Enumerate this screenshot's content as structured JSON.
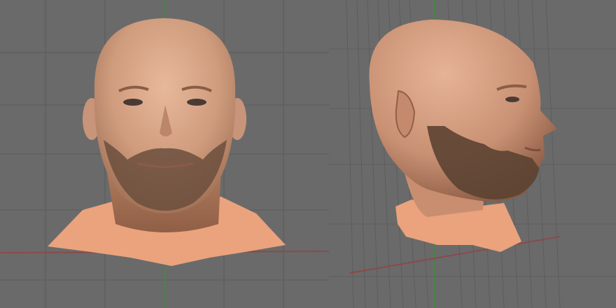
{
  "scene": {
    "background_color": "#6a6a6a",
    "grid_color": "#5a5a5a",
    "axis_x_color": "#8a4a4a",
    "axis_y_color": "#3f8a3f",
    "skin_color": "#eaa37d",
    "head_color": "#d59f80",
    "beard_color": "#5c4332"
  },
  "viewports": [
    {
      "view": "front"
    },
    {
      "view": "side"
    }
  ]
}
